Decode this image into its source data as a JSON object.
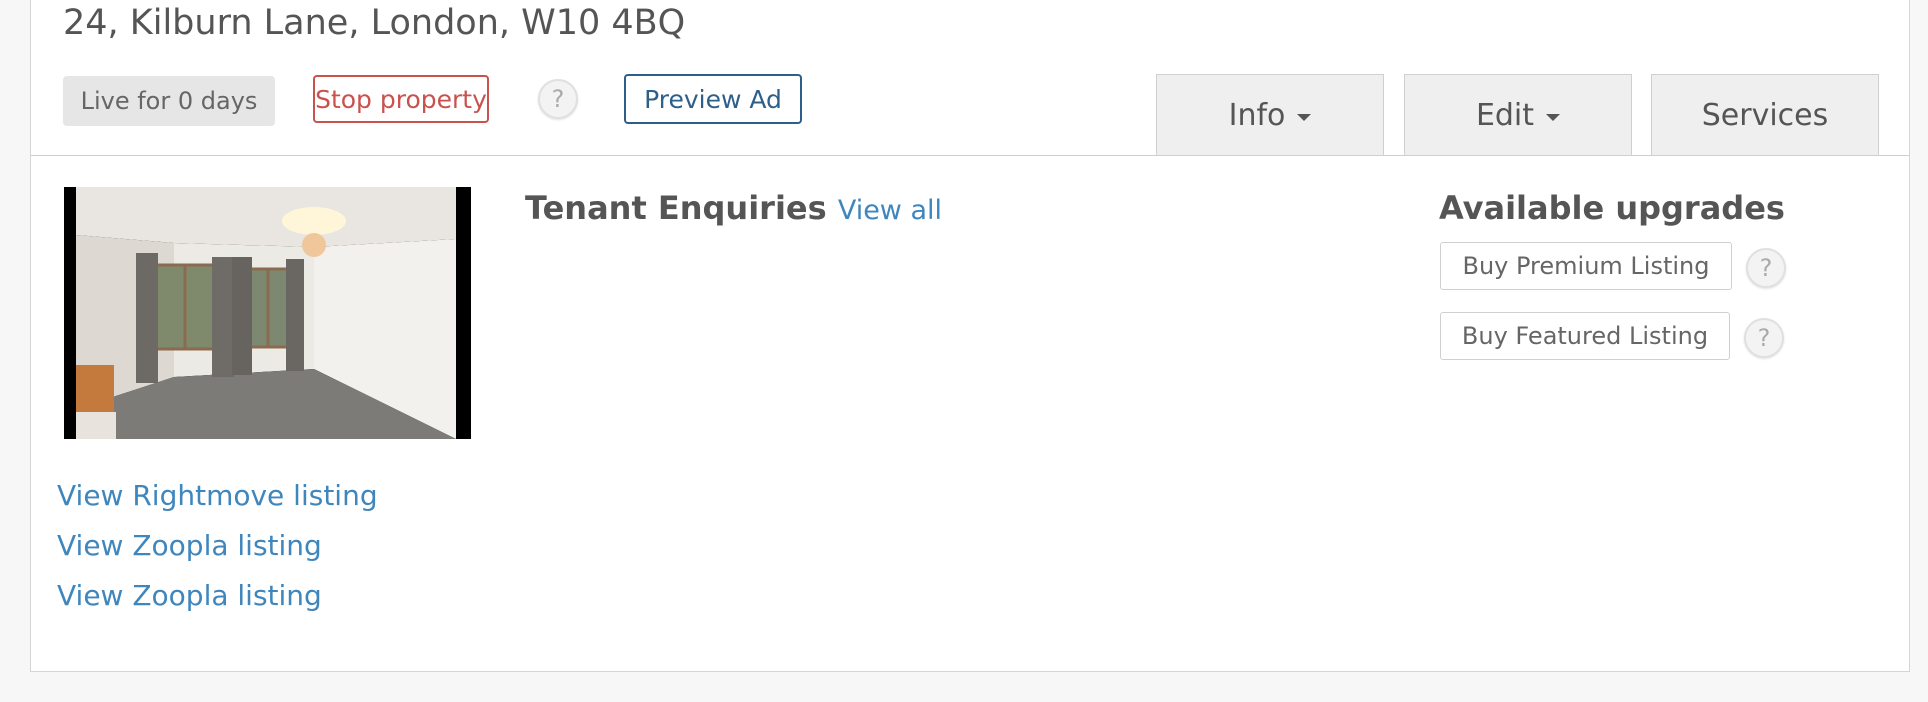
{
  "listing": {
    "address": "24, Kilburn Lane, London, W10 4BQ",
    "live_badge": "Live for 0 days",
    "stop_label": "Stop property",
    "preview_label": "Preview Ad",
    "help_glyph": "?"
  },
  "tabs": [
    {
      "label": "Info",
      "dropdown": true
    },
    {
      "label": "Edit",
      "dropdown": true
    },
    {
      "label": "Services",
      "dropdown": false
    }
  ],
  "links": [
    "View Rightmove listing",
    "View Zoopla listing",
    "View Zoopla listing"
  ],
  "enquiries": {
    "title": "Tenant Enquiries",
    "view_all": "View all"
  },
  "upgrades": {
    "title": "Available upgrades",
    "items": [
      "Buy Premium Listing",
      "Buy Featured Listing"
    ]
  },
  "colors": {
    "link": "#3f86bd",
    "stop": "#c9524d",
    "preview": "#2e5f8a"
  },
  "icons": {
    "help": "question-circle-icon",
    "dropdown": "caret-down-icon"
  }
}
